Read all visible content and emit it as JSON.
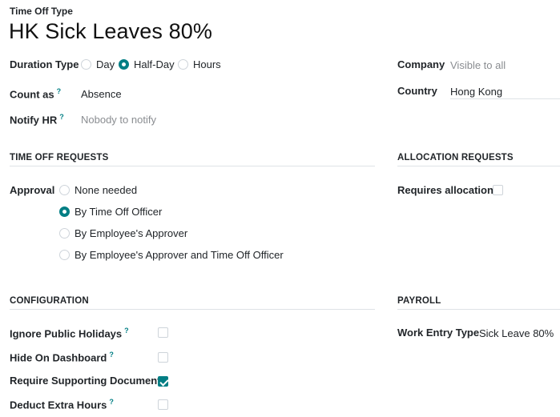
{
  "header": {
    "form_label": "Time Off Type",
    "title": "HK Sick Leaves 80%"
  },
  "general": {
    "duration_type": {
      "label": "Duration Type",
      "options": [
        {
          "label": "Day",
          "selected": false
        },
        {
          "label": "Half-Day",
          "selected": true
        },
        {
          "label": "Hours",
          "selected": false
        }
      ]
    },
    "count_as": {
      "label": "Count as",
      "help": "?",
      "value": "Absence"
    },
    "notify_hr": {
      "label": "Notify HR",
      "help": "?",
      "placeholder": "Nobody to notify"
    },
    "company": {
      "label": "Company",
      "placeholder": "Visible to all"
    },
    "country": {
      "label": "Country",
      "value": "Hong Kong"
    }
  },
  "time_off_requests": {
    "heading": "TIME OFF REQUESTS",
    "approval_label": "Approval",
    "options": [
      {
        "label": "None needed",
        "selected": false
      },
      {
        "label": "By Time Off Officer",
        "selected": true
      },
      {
        "label": "By Employee's Approver",
        "selected": false
      },
      {
        "label": "By Employee's Approver and Time Off Officer",
        "selected": false
      }
    ]
  },
  "allocation_requests": {
    "heading": "ALLOCATION REQUESTS",
    "requires_allocation": {
      "label": "Requires allocation",
      "checked": false
    }
  },
  "configuration": {
    "heading": "CONFIGURATION",
    "items": [
      {
        "label": "Ignore Public Holidays",
        "help": "?",
        "checked": false
      },
      {
        "label": "Hide On Dashboard",
        "help": "?",
        "checked": false
      },
      {
        "label": "Require Supporting Document",
        "help": "",
        "checked": true
      },
      {
        "label": "Deduct Extra Hours",
        "help": "?",
        "checked": false
      }
    ]
  },
  "payroll": {
    "heading": "PAYROLL",
    "work_entry_type": {
      "label": "Work Entry Type",
      "value": "Sick Leave 80%"
    }
  },
  "colors": {
    "accent": "#017e84",
    "muted": "#8a8d91",
    "border": "#dee2e6"
  }
}
